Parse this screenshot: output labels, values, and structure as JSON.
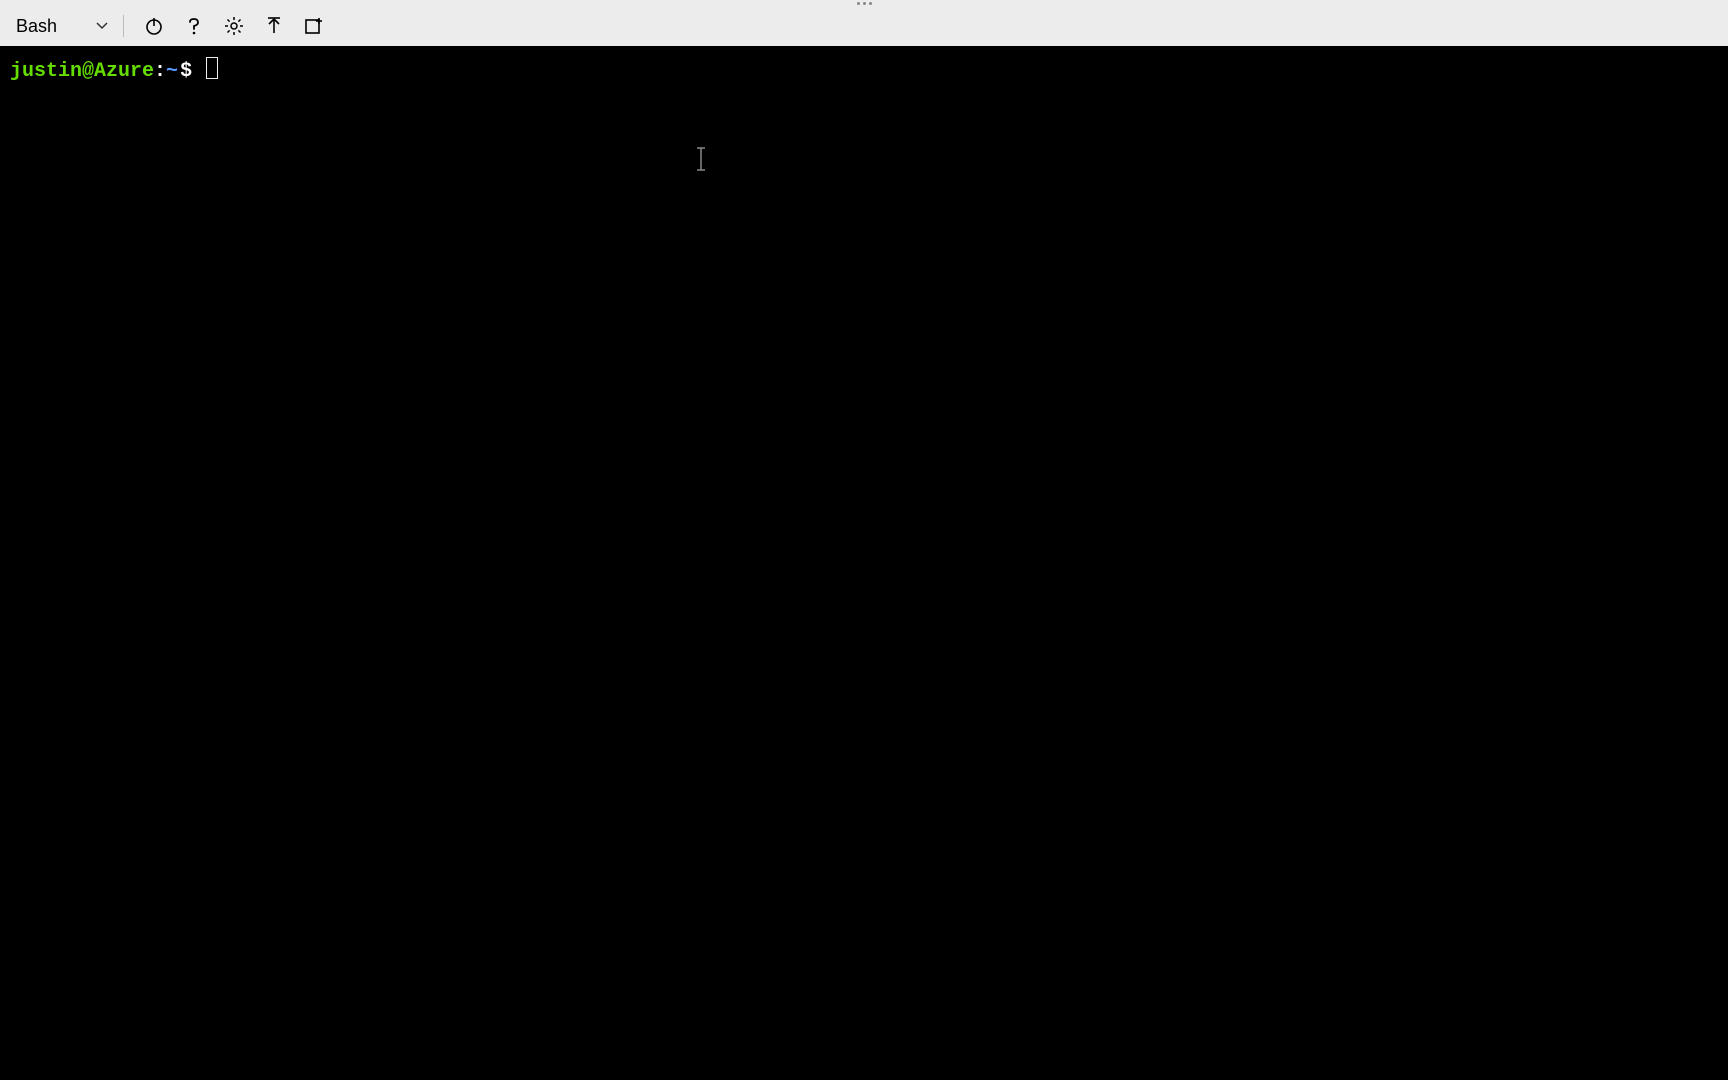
{
  "toolbar": {
    "shell_label": "Bash",
    "icons": {
      "chevron": "chevron-down-icon",
      "power": "power-icon",
      "help": "help-icon",
      "settings": "gear-icon",
      "upload": "upload-icon",
      "newfile": "new-session-icon"
    }
  },
  "terminal": {
    "prompt_user_host": "justin@Azure",
    "prompt_colon": ":",
    "prompt_path": "~",
    "prompt_symbol": "$"
  }
}
